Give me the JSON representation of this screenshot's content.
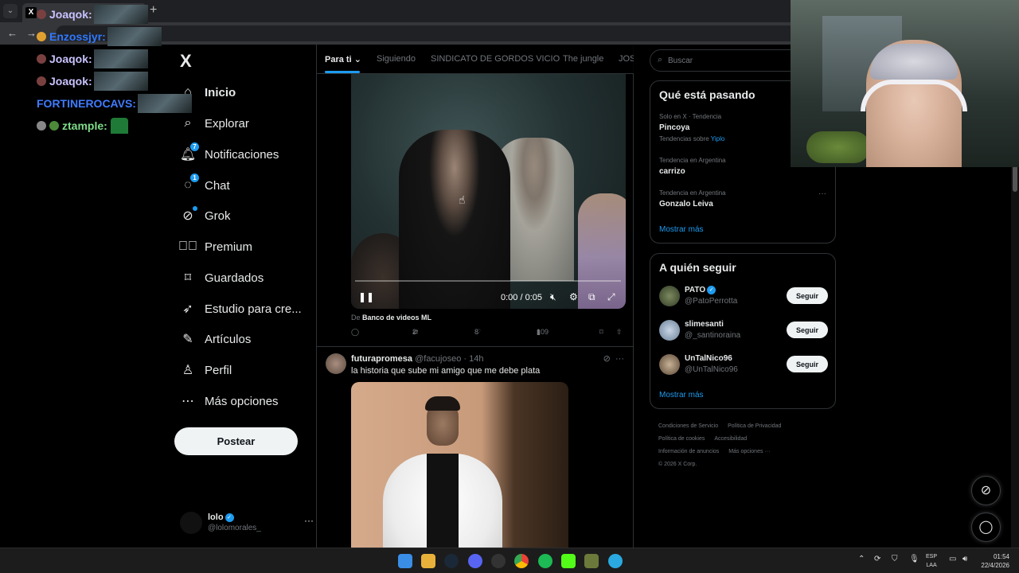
{
  "browser": {
    "tab_icon": "x-logo",
    "tab_list_icon": "chevron-down-icon",
    "new_tab_icon": "plus-icon"
  },
  "chat": [
    {
      "user": "Joaqok:",
      "color": "#c9c3ff"
    },
    {
      "user": "Enzossjyr:",
      "color": "#2f78ff"
    },
    {
      "user": "Joaqok:",
      "color": "#c9c3ff"
    },
    {
      "user": "Joaqok:",
      "color": "#c9c3ff"
    },
    {
      "user": "FORTINEROCAVS:",
      "color": "#3f7cff"
    },
    {
      "user": "ztample:",
      "color": "#7fdc8a"
    }
  ],
  "sidebar": {
    "logo": "X",
    "items": [
      {
        "label": "Inicio",
        "icon": "home-icon"
      },
      {
        "label": "Explorar",
        "icon": "search-icon"
      },
      {
        "label": "Notificaciones",
        "icon": "bell-icon",
        "badge": "7"
      },
      {
        "label": "Chat",
        "icon": "chat-icon",
        "badge": "1"
      },
      {
        "label": "Grok",
        "icon": "grok-icon"
      },
      {
        "label": "Premium",
        "icon": "premium-icon"
      },
      {
        "label": "Guardados",
        "icon": "bookmark-icon"
      },
      {
        "label": "Estudio para cre...",
        "icon": "rocket-icon"
      },
      {
        "label": "Artículos",
        "icon": "article-icon"
      },
      {
        "label": "Perfil",
        "icon": "person-icon"
      },
      {
        "label": "Más opciones",
        "icon": "more-circle-icon"
      }
    ],
    "post_label": "Postear",
    "profile": {
      "name": "lolo",
      "handle": "@lolomorales_"
    }
  },
  "timeline": {
    "tabs": [
      "Para ti",
      "Siguiendo",
      "SINDICATO DE GORDOS VICIO",
      "The jungle",
      "JOS"
    ],
    "video": {
      "time": "0:00 / 0:05",
      "progress": 0,
      "source_prefix": "De",
      "source_name": "Banco de videos ML"
    },
    "actions": {
      "reposts": "2",
      "likes": "8",
      "views": "109"
    },
    "tweet2": {
      "name": "futurapromesa",
      "handle": "@facujoseo",
      "time": "· 14h",
      "text": "la historia que sube mi amigo que me debe plata"
    }
  },
  "right": {
    "search_placeholder": "Buscar",
    "trends_title": "Qué está pasando",
    "trends": [
      {
        "meta": "Solo en X · Tendencia",
        "name": "Pincoya",
        "sub_prefix": "Tendencias sobre ",
        "sub_link": "Yiplo"
      },
      {
        "meta": "Tendencia en Argentina",
        "name": "carrizo"
      },
      {
        "meta": "Tendencia en Argentina",
        "name": "Gonzalo Leiva"
      }
    ],
    "show_more": "Mostrar más",
    "follow_title": "A quién seguir",
    "follow": [
      {
        "name": "PATO",
        "handle": "@PatoPerrotta",
        "verified": true,
        "avatar_color": "#3b4a2f"
      },
      {
        "name": "slimesanti",
        "handle": "@_santinoraina",
        "verified": false,
        "avatar_color": "#8aa0b8"
      },
      {
        "name": "UnTalNico96",
        "handle": "@UnTalNico96",
        "verified": false,
        "avatar_color": "#6b5a45"
      }
    ],
    "follow_button": "Seguir",
    "footer": [
      "Condiciones de Servicio",
      "Política de Privacidad",
      "Política de cookies",
      "Accesibilidad",
      "Información de anuncios",
      "Más opciones ···",
      "© 2026 X Corp."
    ]
  },
  "taskbar": {
    "lang": "ESP",
    "lang2": "LAA",
    "time": "01:54",
    "date": "22/4/2026"
  },
  "colors": {
    "accent": "#1d9bf0",
    "background": "#000000",
    "border": "#2f3336"
  }
}
